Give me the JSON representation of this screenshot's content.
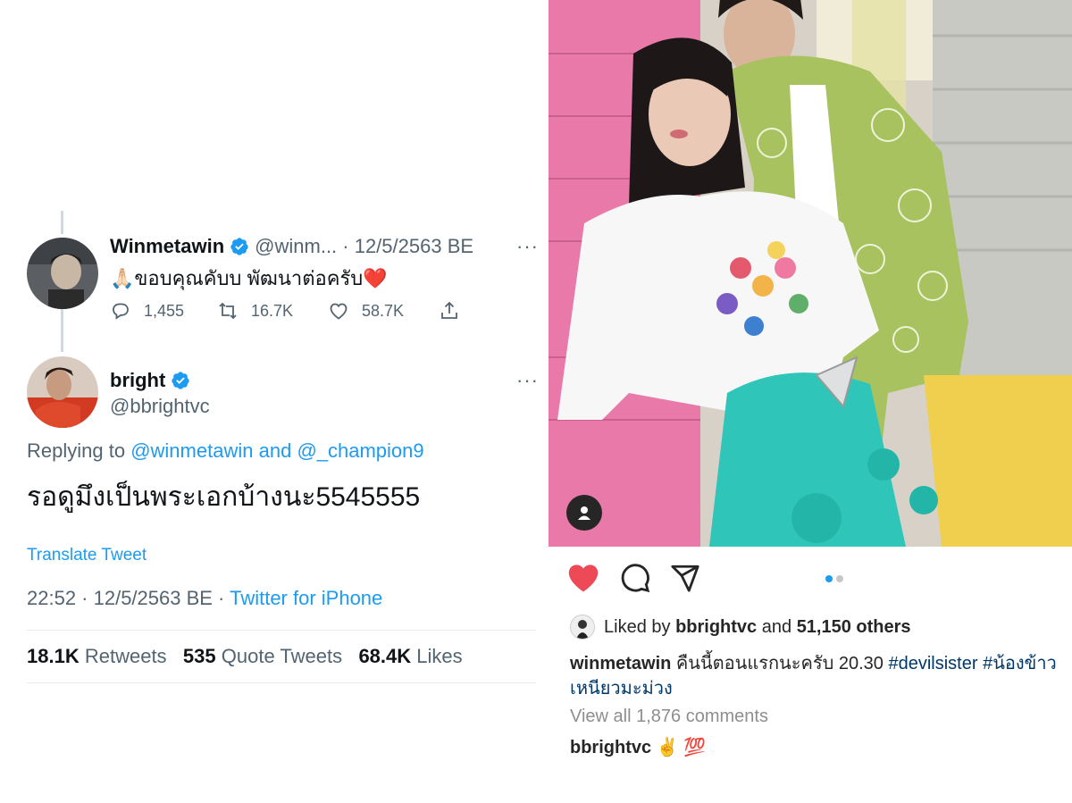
{
  "tweet1": {
    "name": "Winmetawin",
    "handle_date": "@winm... · 12/5/2563 BE",
    "text": "🙏🏻ขอบคุณคับบ พัฒนาต่อครับ❤️",
    "replies": "1,455",
    "retweets": "16.7K",
    "likes": "58.7K",
    "more": "···"
  },
  "tweet2": {
    "name": "bright",
    "handle": "@bbrightvc",
    "more": "···",
    "replying_prefix": "Replying to",
    "replying_user1": "@winmetawin",
    "replying_and": "and",
    "replying_user2": "@_champion9",
    "text": "รอดูมึงเป็นพระเอกบ้างนะ5545555",
    "translate": "Translate Tweet",
    "time_date": "22:52 · 12/5/2563 BE ·",
    "source": "Twitter for iPhone",
    "retweets_count": "18.1K",
    "retweets_label": "Retweets",
    "quotes_count": "535",
    "quotes_label": "Quote Tweets",
    "likes_count": "68.4K",
    "likes_label": "Likes"
  },
  "instagram": {
    "liked_prefix": "Liked by",
    "liked_user": "bbrightvc",
    "liked_and": "and",
    "liked_others": "51,150 others",
    "caption_user": "winmetawin",
    "caption_text": "คืนนี้ตอนแรกนะครับ 20.30",
    "caption_tag1": "#devilsister",
    "caption_tag2": "#น้องข้าวเหนียวมะม่วง",
    "view_comments": "View all 1,876 comments",
    "comment_user": "bbrightvc",
    "comment_text": "✌️ 💯",
    "carousel_active_index": 0,
    "carousel_count": 2
  },
  "colors": {
    "twitter_blue": "#1d9bf0",
    "ig_like_red": "#ed4956",
    "ig_link": "#00376b"
  },
  "icons": [
    "reply-icon",
    "retweet-icon",
    "like-icon",
    "share-icon",
    "verified-badge-icon",
    "more-icon",
    "heart-filled-icon",
    "comment-icon",
    "send-icon",
    "user-tag-icon"
  ]
}
